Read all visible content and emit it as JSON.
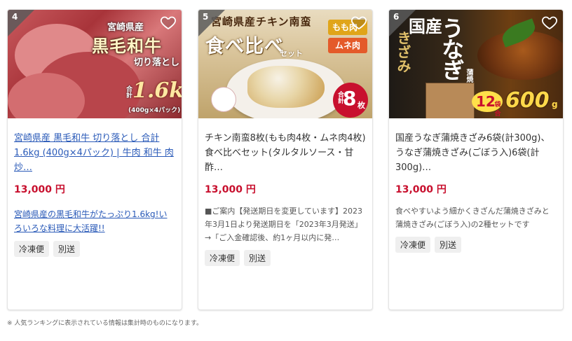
{
  "products": [
    {
      "rank": "4",
      "image_text": {
        "pref": "宮崎県産",
        "main": "黒毛和牛",
        "sub": "切り落とし",
        "weight_label": "合計",
        "weight": "1.6kg",
        "weight_note": "(400g×4パック)"
      },
      "name": "宮崎県産 黒毛和牛 切り落とし 合計1.6kg (400g×4パック) | 牛肉 和牛 肉 炒…",
      "price": "13,000 円",
      "description": "宮崎県産の黒毛和牛がたっぷり1.6kg!いろいろな料理に大活躍!!",
      "tags": [
        "冷凍便",
        "別送"
      ]
    },
    {
      "rank": "5",
      "image_text": {
        "title": "宮崎県産チキン南蛮",
        "big": "食べ比べ",
        "set": "セット",
        "tag1": "もも肉",
        "tag2": "ムネ肉",
        "count_label": "合計",
        "count": "8",
        "count_unit": "枚"
      },
      "name": "チキン南蛮8枚(もも肉4枚・ムネ肉4枚)食べ比べセット(タルタルソース・甘酢…",
      "price": "13,000 円",
      "description": "■ご案内【発送期日を変更しています】2023年3月1日より発送期日を「2023年3月発送」→「ご入金確認後、約1ヶ月以内に発…",
      "tags": [
        "冷凍便",
        "別送"
      ]
    },
    {
      "rank": "6",
      "image_text": {
        "kokusan": "国産",
        "unagi": "うなぎ",
        "kizami": "きざみ",
        "kabayaki": "蒲焼",
        "packs": "12",
        "packs_unit": "袋合計",
        "grams": "600",
        "grams_unit": "g"
      },
      "name": "国産うなぎ蒲焼きざみ6袋(計300g)、うなぎ蒲焼きざみ(ごぼう入)6袋(計300g)…",
      "price": "13,000 円",
      "description": "食べやすいよう細かくきざんだ蒲焼きざみと蒲焼きざみ(ごぼう入)の2種セットです",
      "tags": [
        "冷凍便",
        "別送"
      ]
    }
  ],
  "footnote": "※ 人気ランキングに表示されている情報は集計時のものになります。",
  "icons": {
    "favorite": "heart-outline-icon"
  },
  "colors": {
    "price": "#c8102e",
    "link": "#2a5ab8",
    "tag_bg": "#efefef"
  }
}
